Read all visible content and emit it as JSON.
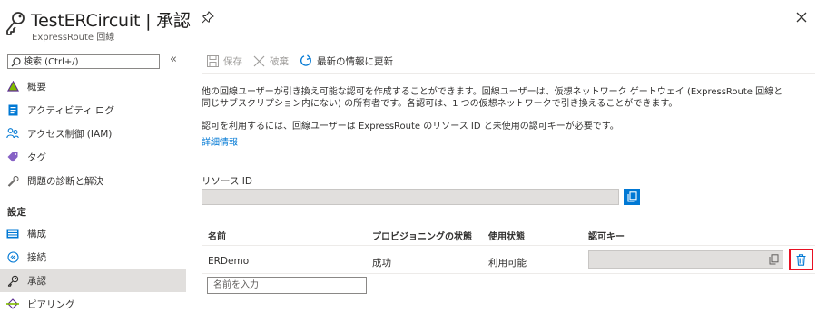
{
  "header": {
    "title": "TestERCircuit | 承認",
    "subtitle": "ExpressRoute 回線"
  },
  "sidebar": {
    "search_placeholder": "検索 (Ctrl+/)",
    "collapse_label": "«",
    "items": [
      {
        "label": "概要",
        "icon": "triangle-icon"
      },
      {
        "label": "アクティビティ ログ",
        "icon": "log-icon"
      },
      {
        "label": "アクセス制御 (IAM)",
        "icon": "people-icon"
      },
      {
        "label": "タグ",
        "icon": "tag-icon"
      },
      {
        "label": "問題の診断と解決",
        "icon": "wrench-icon"
      }
    ],
    "section_label": "設定",
    "settings_items": [
      {
        "label": "構成",
        "icon": "config-icon"
      },
      {
        "label": "接続",
        "icon": "connection-icon"
      },
      {
        "label": "承認",
        "icon": "key-icon",
        "active": true
      },
      {
        "label": "ピアリング",
        "icon": "peering-icon"
      }
    ]
  },
  "toolbar": {
    "save_label": "保存",
    "discard_label": "破棄",
    "refresh_label": "最新の情報に更新"
  },
  "main": {
    "desc_line1": "他の回線ユーザーが引き換え可能な認可を作成することができます。回線ユーザーは、仮想ネットワーク ゲートウェイ (ExpressRoute 回線と",
    "desc_line2": "同じサブスクリプション内にない) の所有者です。各認可は、1 つの仮想ネットワークで引き換えることができます。",
    "desc_line3": "認可を利用するには、回線ユーザーは ExpressRoute のリソース ID と未使用の認可キーが必要です。",
    "more_info_link": "詳細情報",
    "resource_id_label": "リソース ID",
    "resource_id_value": ""
  },
  "table": {
    "headers": [
      "名前",
      "プロビジョニングの状態",
      "使用状態",
      "認可キー"
    ],
    "rows": [
      {
        "name": "ERDemo",
        "provisioning": "成功",
        "usage": "利用可能",
        "key": ""
      }
    ],
    "new_name_placeholder": "名前を入力"
  },
  "colors": {
    "accent": "#0078d4",
    "delete_highlight": "#e81123",
    "active_nav": "#e1dfdd",
    "disabled_text": "#a19f9d"
  }
}
